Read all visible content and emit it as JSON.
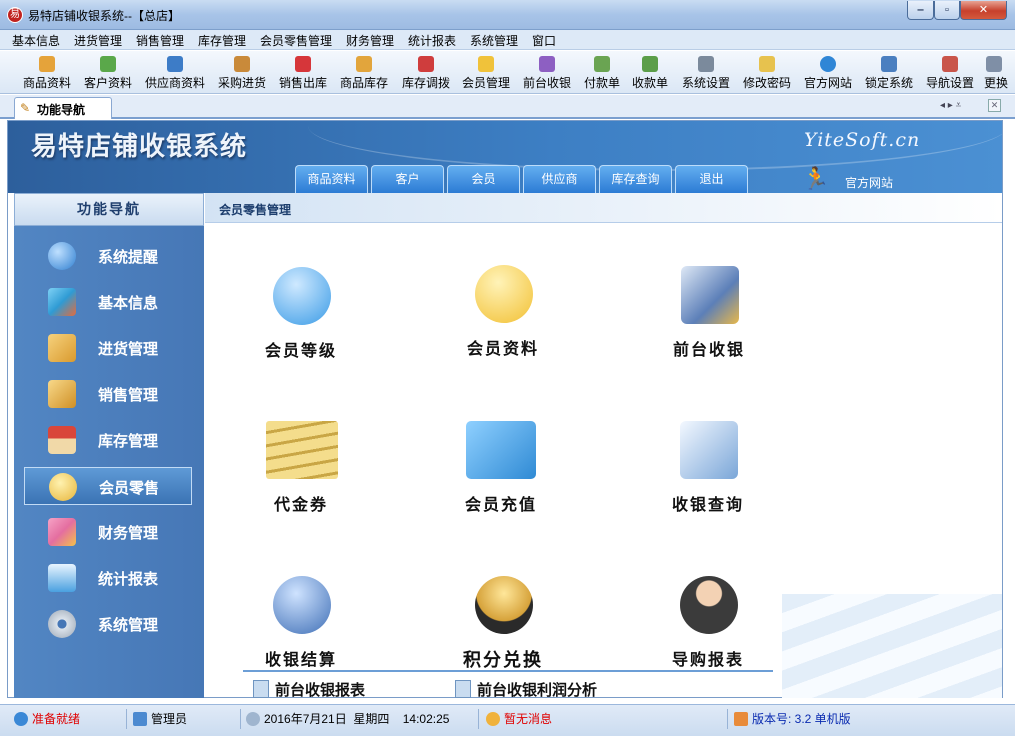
{
  "window": {
    "title": "易特店铺收银系统--【总店】",
    "app_icon": "易"
  },
  "window_controls": {
    "min": "‒",
    "max": "▫",
    "close": "✕"
  },
  "menu": [
    "基本信息",
    "进货管理",
    "销售管理",
    "库存管理",
    "会员零售管理",
    "财务管理",
    "统计报表",
    "系统管理",
    "窗口"
  ],
  "toolbar": [
    {
      "label": "商品资料",
      "icon": "goods-icon"
    },
    {
      "label": "客户资料",
      "icon": "customer-icon"
    },
    {
      "label": "供应商资料",
      "icon": "supplier-icon"
    },
    {
      "label": "采购进货",
      "icon": "purchase-icon"
    },
    {
      "label": "销售出库",
      "icon": "sales-icon"
    },
    {
      "label": "商品库存",
      "icon": "stock-icon"
    },
    {
      "label": "库存调拨",
      "icon": "transfer-icon"
    },
    {
      "label": "会员管理",
      "icon": "member-icon"
    },
    {
      "label": "前台收银",
      "icon": "cashier-icon"
    },
    {
      "label": "付款单",
      "icon": "payment-icon"
    },
    {
      "label": "收款单",
      "icon": "receipt-icon"
    },
    {
      "label": "系统设置",
      "icon": "settings-icon"
    },
    {
      "label": "修改密码",
      "icon": "password-icon"
    },
    {
      "label": "官方网站",
      "icon": "ie-icon"
    },
    {
      "label": "锁定系统",
      "icon": "lock-icon"
    },
    {
      "label": "导航设置",
      "icon": "nav-settings-icon"
    },
    {
      "label": "更换",
      "icon": "switch-icon"
    }
  ],
  "tab": {
    "label": "功能导航",
    "icon": "✎",
    "controls": "◂ ▸ ⩡",
    "close": "✕"
  },
  "banner": {
    "title": "易特店铺收银系统",
    "url": "YiteSoft.cn",
    "tabs": [
      "商品资料",
      "客户",
      "会员",
      "供应商",
      "库存查询",
      "退出"
    ],
    "runner": "🏃",
    "site_label": "官方网站"
  },
  "sidenav": {
    "header": "功能导航",
    "items": [
      {
        "label": "系统提醒",
        "icon": "info-icon",
        "color": "#2f7fd0"
      },
      {
        "label": "基本信息",
        "icon": "cubes-icon",
        "color": "#3aa9e0"
      },
      {
        "label": "进货管理",
        "icon": "box-in-icon",
        "color": "#e0a437"
      },
      {
        "label": "销售管理",
        "icon": "box-out-icon",
        "color": "#d99a2e"
      },
      {
        "label": "库存管理",
        "icon": "house-icon",
        "color": "#d9463a"
      },
      {
        "label": "会员零售",
        "icon": "member-bubble-icon",
        "color": "#e7b53a",
        "selected": true
      },
      {
        "label": "财务管理",
        "icon": "finance-icon",
        "color": "#e46ea0"
      },
      {
        "label": "统计报表",
        "icon": "chart-icon",
        "color": "#4aa0e0"
      },
      {
        "label": "系统管理",
        "icon": "gears-icon",
        "color": "#c9d2dd"
      }
    ]
  },
  "content": {
    "title": "会员零售管理",
    "tiles": [
      {
        "label": "会员等级",
        "icon": "member-level-icon",
        "color": "#3a9be6"
      },
      {
        "label": "会员资料",
        "icon": "member-info-icon",
        "color": "#f2c033"
      },
      {
        "label": "前台收银",
        "icon": "pos-monitor-icon",
        "color": "#5c7fb8"
      },
      {
        "label": "代金券",
        "icon": "voucher-icon",
        "color": "#c9a645"
      },
      {
        "label": "会员充值",
        "icon": "recharge-card-icon",
        "color": "#2f8ad4"
      },
      {
        "label": "收银查询",
        "icon": "query-icon",
        "color": "#7aa6d8"
      },
      {
        "label": "收银结算",
        "icon": "settle-icon",
        "color": "#3f6fb6"
      },
      {
        "label": "积分兑换",
        "icon": "points-exchange-icon",
        "color": "#d6a23a"
      },
      {
        "label": "导购报表",
        "icon": "guide-report-icon",
        "color": "#3b3b3b"
      }
    ],
    "reports": [
      "前台收银报表",
      "前台收银利润分析"
    ]
  },
  "statusbar": {
    "status": "准备就绪",
    "user": "管理员",
    "date": "2016年7月21日",
    "weekday": "星期四",
    "time": "14:02:25",
    "message": "暂无消息",
    "version": "版本号: 3.2 单机版"
  },
  "colors": {
    "accent": "#3d7fc4",
    "status_red": "#e00000",
    "version_blue": "#0a2bb0"
  }
}
